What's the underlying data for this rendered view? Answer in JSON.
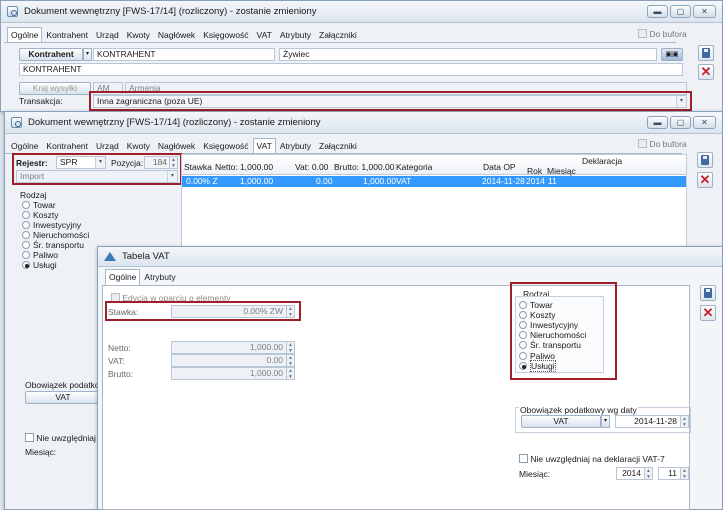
{
  "win1": {
    "title": "Dokument wewnętrzny [FWS-17/14] (rozliczony) - zostanie zmieniony",
    "tabs": [
      "Ogólne",
      "Kontrahent",
      "Urząd",
      "Kwoty",
      "Nagłówek",
      "Księgowość",
      "VAT",
      "Atrybuty",
      "Załączniki"
    ],
    "do_bufora": "Do bufora",
    "kontrahent_btn": "Kontrahent",
    "kontrahent_code": "KONTRAHENT",
    "kontrahent_city": "Żywiec",
    "kontrahent_name": "KONTRAHENT",
    "kraj_btn": "Kraj wysyłki",
    "kraj_code": "AM",
    "kraj_name": "Armenia",
    "transakcja_label": "Transakcja:",
    "transakcja_value": "Inna zagraniczna (poza UE)"
  },
  "win2": {
    "title": "Dokument wewnętrzny [FWS-17/14] (rozliczony) - zostanie zmieniony",
    "tabs": [
      "Ogólne",
      "Kontrahent",
      "Urząd",
      "Kwoty",
      "Nagłówek",
      "Księgowość",
      "VAT",
      "Atrybuty",
      "Załączniki"
    ],
    "do_bufora": "Do bufora",
    "rejestr_label": "Rejestr:",
    "rejestr_value": "SPR",
    "pozycja_label": "Pozycja:",
    "pozycja_value": "184",
    "import_value": "Import",
    "rodzaj_label": "Rodzaj",
    "rodzaj_options": [
      "Towar",
      "Koszty",
      "Inwestycyjny",
      "Nieruchomości",
      "Śr. transportu",
      "Paliwo",
      "Usługi"
    ],
    "rodzaj_selected": "Usługi",
    "obowiazek_label": "Obowiązek podatkow",
    "vat_btn": "VAT",
    "nie_uwzgl": "Nie uwzględniaj na",
    "miesiac_label": "Miesiąc:",
    "grid": {
      "headers": [
        "Stawka",
        "Netto: 1,000.00",
        "Vat: 0.00",
        "Brutto: 1,000.00",
        "Kategoria",
        "Data OP",
        "Rok",
        "Miesiąc"
      ],
      "deklaracja": "Deklaracja",
      "row": [
        "0.00% Z",
        "1,000.00",
        "0.00",
        "1,000.00",
        "VAT",
        "2014-11-28",
        "2014",
        "11"
      ]
    }
  },
  "win3": {
    "title": "Tabela VAT",
    "tabs": [
      "Ogólne",
      "Atrybuty"
    ],
    "edycja": "Edycja w oparciu o elementy",
    "stawka_label": "Stawka:",
    "stawka_value": "0.00% ZW",
    "netto_label": "Netto:",
    "netto_value": "1,000.00",
    "vat_label": "VAT:",
    "vat_value": "0.00",
    "brutto_label": "Brutto:",
    "brutto_value": "1,000.00",
    "rodzaj_label": "Rodzaj",
    "rodzaj_options": [
      "Towar",
      "Koszty",
      "Inwestycyjny",
      "Nieruchomości",
      "Śr. transportu",
      "Paliwo",
      "Usługi"
    ],
    "rodzaj_selected": "Usługi",
    "obowiazek_label": "Obowiązek podatkowy wg daty",
    "vat_btn": "VAT",
    "obowiazek_date": "2014-11-28",
    "nie_uwzgl": "Nie uwzględniaj na deklaracji VAT-7",
    "miesiac_label": "Miesiąc:",
    "rok_value": "2014",
    "miesiac_value": "11"
  },
  "colors": {
    "accent": "#3399ff",
    "highlight_box": "#a11d2a",
    "grid_selected": "#3399ff"
  },
  "icons": {
    "save": "save-icon",
    "cancel": "close-icon",
    "app": "app-icon"
  }
}
